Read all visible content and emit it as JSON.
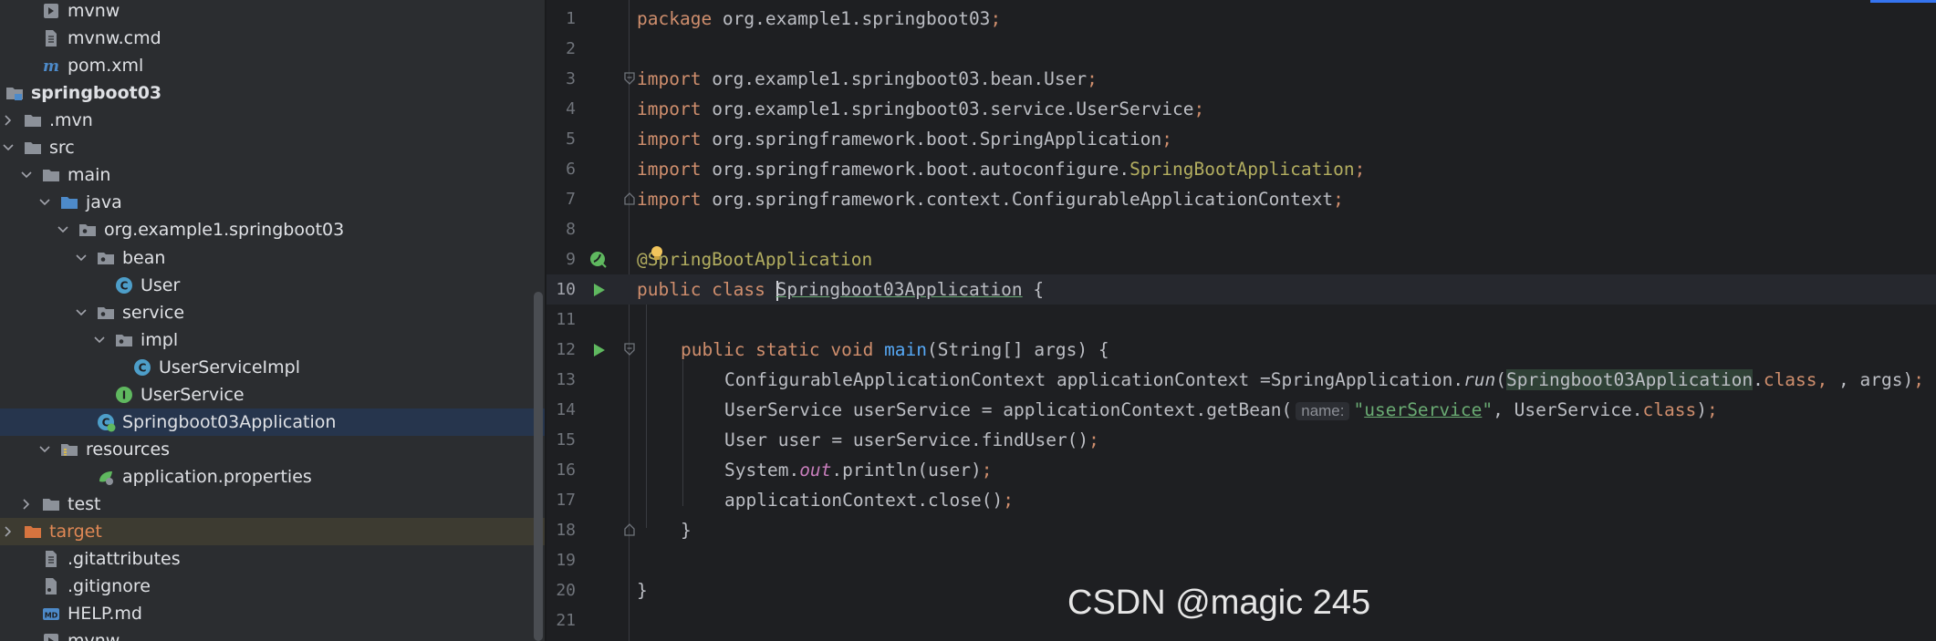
{
  "tree": {
    "items": [
      {
        "label": "mvnw",
        "indent": 0,
        "chevron": "none",
        "icon": "script-file-icon",
        "bold": false
      },
      {
        "label": "mvnw.cmd",
        "indent": 0,
        "chevron": "none",
        "icon": "text-file-icon",
        "bold": false
      },
      {
        "label": "pom.xml",
        "indent": 0,
        "chevron": "none",
        "icon": "maven-icon",
        "bold": false
      },
      {
        "label": "springboot03",
        "indent": -2,
        "chevron": "down",
        "icon": "module-folder-icon",
        "bold": true
      },
      {
        "label": ".mvn",
        "indent": -1,
        "chevron": "right",
        "icon": "folder-icon",
        "bold": false
      },
      {
        "label": "src",
        "indent": -1,
        "chevron": "down",
        "icon": "folder-icon",
        "bold": false
      },
      {
        "label": "main",
        "indent": 0,
        "chevron": "down",
        "icon": "folder-icon",
        "bold": false
      },
      {
        "label": "java",
        "indent": 1,
        "chevron": "down",
        "icon": "source-folder-icon",
        "bold": false
      },
      {
        "label": "org.example1.springboot03",
        "indent": 2,
        "chevron": "down",
        "icon": "package-icon",
        "bold": false
      },
      {
        "label": "bean",
        "indent": 3,
        "chevron": "down",
        "icon": "package-icon",
        "bold": false
      },
      {
        "label": "User",
        "indent": 4,
        "chevron": "none",
        "icon": "class-icon",
        "bold": false
      },
      {
        "label": "service",
        "indent": 3,
        "chevron": "down",
        "icon": "package-icon",
        "bold": false
      },
      {
        "label": "impl",
        "indent": 4,
        "chevron": "down",
        "icon": "package-icon",
        "bold": false
      },
      {
        "label": "UserServiceImpl",
        "indent": 5,
        "chevron": "none",
        "icon": "class-icon",
        "bold": false
      },
      {
        "label": "UserService",
        "indent": 4,
        "chevron": "none",
        "icon": "interface-icon",
        "bold": false
      },
      {
        "label": "Springboot03Application",
        "indent": 3,
        "chevron": "none",
        "icon": "spring-boot-class-icon",
        "bold": false,
        "selected": true
      },
      {
        "label": "resources",
        "indent": 1,
        "chevron": "down",
        "icon": "resources-folder-icon",
        "bold": false
      },
      {
        "label": "application.properties",
        "indent": 3,
        "chevron": "none",
        "icon": "spring-properties-icon",
        "bold": false
      },
      {
        "label": "test",
        "indent": 0,
        "chevron": "right",
        "icon": "folder-icon",
        "bold": false
      },
      {
        "label": "target",
        "indent": -1,
        "chevron": "right",
        "icon": "excluded-folder-icon",
        "bold": false,
        "target": true
      },
      {
        "label": ".gitattributes",
        "indent": 0,
        "chevron": "none",
        "icon": "text-file-icon",
        "bold": false
      },
      {
        "label": ".gitignore",
        "indent": 0,
        "chevron": "none",
        "icon": "gitignore-icon",
        "bold": false
      },
      {
        "label": "HELP.md",
        "indent": 0,
        "chevron": "none",
        "icon": "markdown-icon",
        "bold": false
      },
      {
        "label": "mvnw",
        "indent": 0,
        "chevron": "none",
        "icon": "script-file-icon",
        "bold": false
      }
    ]
  },
  "editor": {
    "line_numbers": [
      "1",
      "2",
      "3",
      "4",
      "5",
      "6",
      "7",
      "8",
      "9",
      "10",
      "11",
      "12",
      "13",
      "14",
      "15",
      "16",
      "17",
      "18",
      "19",
      "20",
      "21"
    ],
    "current_line": 10,
    "code": {
      "l1_kw": "package",
      "l1_rest": " org.example1.springboot03",
      "l3_kw": "import",
      "l3_rest": " org.example1.springboot03.bean.User",
      "l4_kw": "import",
      "l4_rest": " org.example1.springboot03.service.UserService",
      "l5_kw": "import",
      "l5_rest": " org.springframework.boot.SpringApplication",
      "l6_kw": "import",
      "l6_rest": " org.springframework.boot.autoconfigure.",
      "l6_ann": "SpringBootApplication",
      "l7_kw": "import",
      "l7_rest": " org.springframework.context.ConfigurableApplicationContext",
      "l9_ann": "@SpringBootApplication",
      "l10_kw": "public class ",
      "l10_name": "Springboot03Application",
      "l10_rest": " {",
      "l12_kw": "public static void ",
      "l12_fn": "main",
      "l12_rest": "(String[] args) {",
      "l13_a": "ConfigurableApplicationContext applicationContext =SpringApplication.",
      "l13_run": "run",
      "l13_b": "(",
      "l13_cls": "Springboot03Application",
      "l13_dot": ".",
      "l13_kw": "class",
      "l13_c": ", args)",
      "l14_a": "UserService userService = applicationContext.getBean(",
      "l14_hint": "name:",
      "l14_q1": "\"",
      "l14_str": "userService",
      "l14_q2": "\"",
      "l14_b": ", UserService.",
      "l14_kw": "class",
      "l14_c": ")",
      "l15_a": "User user = userService.findUser()",
      "l16_a": "System.",
      "l16_out": "out",
      "l16_b": ".println(user)",
      "l17_a": "applicationContext.close()",
      "l18_a": "}",
      "l20_a": "}",
      "semicolon": ";",
      "comma": ", "
    }
  },
  "watermark": "CSDN @magic 245"
}
